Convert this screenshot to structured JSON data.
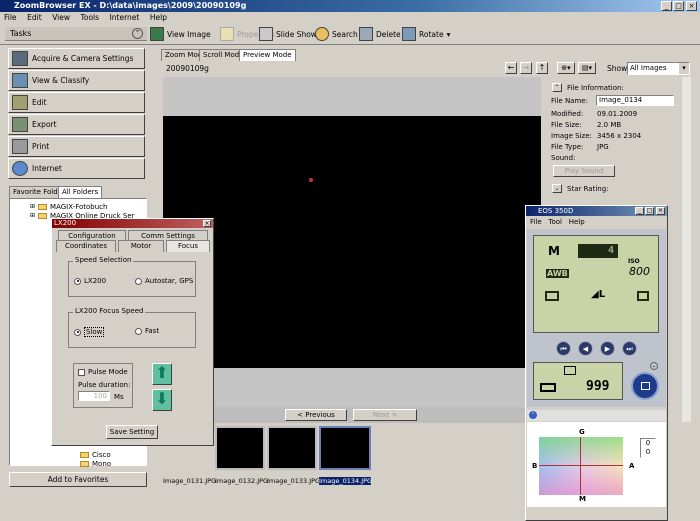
{
  "app": {
    "title": "ZoomBrowser EX  -  D:\\data\\images\\2009\\20090109g",
    "menu": [
      "File",
      "Edit",
      "View",
      "Tools",
      "Internet",
      "Help"
    ]
  },
  "toolbar": {
    "view_image": "View Image",
    "properties": "Properties",
    "slide_show": "Slide Show",
    "search": "Search",
    "delete": "Delete",
    "rotate": "Rotate"
  },
  "tasks": {
    "title": "Tasks",
    "items": [
      {
        "label": "Acquire & Camera Settings"
      },
      {
        "label": "View & Classify"
      },
      {
        "label": "Edit"
      },
      {
        "label": "Export"
      },
      {
        "label": "Print"
      },
      {
        "label": "Internet"
      }
    ]
  },
  "folders": {
    "tab_favorite": "Favorite Folders",
    "tab_all": "All Folders",
    "tree": [
      "MAGIX-Fotobuch",
      "MAGIX Online Druck Ser"
    ],
    "tree_bottom": [
      "Cisco",
      "Mono"
    ],
    "add_to_favorites": "Add to Favorites"
  },
  "view": {
    "tabs": [
      "Zoom Mode",
      "Scroll Mode",
      "Preview Mode"
    ],
    "folder_name": "20090109g",
    "show_label": "Show",
    "show_value": "All Images",
    "previous": "< Previous",
    "next": "Next >"
  },
  "file_info": {
    "title": "File Information:",
    "fields": [
      {
        "label": "File Name:",
        "value": "Image_0134"
      },
      {
        "label": "Modified:",
        "value": "09.01.2009"
      },
      {
        "label": "File Size:",
        "value": "2.0 MB"
      },
      {
        "label": "Image Size:",
        "value": "3456 x 2304"
      },
      {
        "label": "File Type:",
        "value": "JPG"
      },
      {
        "label": "Sound:",
        "value": ""
      }
    ],
    "play_sound": "Play Sound",
    "star_rating": "Star Rating:"
  },
  "thumbnails": [
    {
      "label": "Image_0131.JPG"
    },
    {
      "label": "Image_0132.JPG"
    },
    {
      "label": "Image_0133.JPG"
    },
    {
      "label": "Image_0134.JPG"
    }
  ],
  "lx200": {
    "title": "LX200",
    "tabs_top": [
      "Configuration",
      "Comm Settings"
    ],
    "tabs_bottom": [
      "Coordinates",
      "Motor",
      "Focus"
    ],
    "speed_group": "Speed Selection",
    "speed_options": [
      "LX200",
      "Autostar, GPS"
    ],
    "focus_group": "LX200 Focus Speed",
    "focus_options": [
      "Slow",
      "Fast"
    ],
    "pulse_mode": "Pulse Mode",
    "pulse_duration": "Pulse duration:",
    "pulse_value": "100",
    "pulse_unit": "Ms",
    "save": "Save Setting"
  },
  "eos": {
    "title": "EOS 350D",
    "menu": [
      "File",
      "Tool",
      "Help"
    ],
    "mode": "M",
    "shutter": "4",
    "iso_label": "ISO",
    "iso": "800",
    "awb": "AWB",
    "quality": "L",
    "shots": "999",
    "axis_top": "G",
    "axis_bottom": "M",
    "axis_left": "B",
    "axis_right": "A",
    "shift_a": "0",
    "shift_b": "0"
  }
}
